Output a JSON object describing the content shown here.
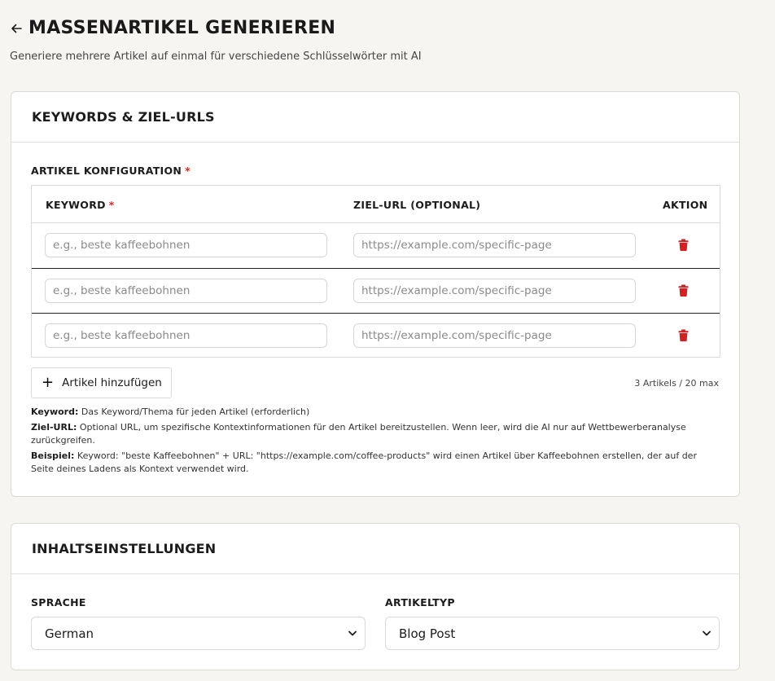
{
  "header": {
    "title": "MASSENARTIKEL GENERIEREN",
    "subtitle": "Generiere mehrere Artikel auf einmal für verschiedene Schlüsselwörter mit AI",
    "back_icon": "arrow-left-icon"
  },
  "keywords_card": {
    "title": "KEYWORDS & ZIEL-URLS",
    "section_label": "ARTIKEL KONFIGURATION",
    "required_mark": "*",
    "table": {
      "col_keyword": "KEYWORD",
      "col_url": "ZIEL-URL (OPTIONAL)",
      "col_action": "AKTION",
      "rows": [
        {
          "keyword_placeholder": "e.g., beste kaffeebohnen",
          "url_placeholder": "https://example.com/specific-page"
        },
        {
          "keyword_placeholder": "e.g., beste kaffeebohnen",
          "url_placeholder": "https://example.com/specific-page"
        },
        {
          "keyword_placeholder": "e.g., beste kaffeebohnen",
          "url_placeholder": "https://example.com/specific-page"
        }
      ]
    },
    "add_button": "Artikel hinzufügen",
    "count": "3 Artikels / 20 max",
    "notes": {
      "keyword_label": "Keyword:",
      "keyword_text": " Das Keyword/Thema für jeden Artikel (erforderlich)",
      "url_label": "Ziel-URL:",
      "url_text": " Optional URL, um spezifische Kontextinformationen für den Artikel bereitzustellen. Wenn leer, wird die AI nur auf Wettbewerberanalyse zurückgreifen.",
      "example_label": "Beispiel:",
      "example_text": " Keyword: \"beste Kaffeebohnen\" + URL: \"https://example.com/coffee-products\" wird einen Artikel über Kaffeebohnen erstellen, der auf der Seite deines Ladens als Kontext verwendet wird."
    }
  },
  "content_card": {
    "title": "INHALTSEINSTELLUNGEN",
    "language_label": "SPRACHE",
    "language_value": "German",
    "type_label": "ARTIKELTYP",
    "type_value": "Blog Post"
  },
  "colors": {
    "required": "#d42a2a",
    "trash": "#d42020",
    "background": "#f6f5f2"
  }
}
